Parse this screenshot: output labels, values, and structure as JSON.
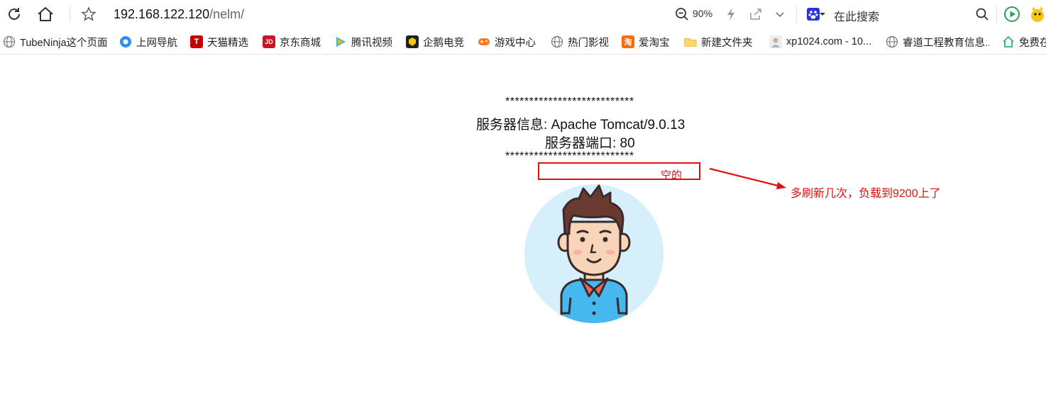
{
  "toolbar": {
    "url_host": "192.168.122.120",
    "url_path": "/nelm/",
    "zoom": "90%",
    "search_placeholder": "在此搜索"
  },
  "bookmarks": [
    {
      "label": "TubeNinja这个页面",
      "icon": "globe-icon",
      "color": "#888888"
    },
    {
      "label": "上网导航",
      "icon": "navigation-icon",
      "color": "#2b8ff0"
    },
    {
      "label": "天猫精选",
      "icon": "tmall-icon",
      "color": "#c40000"
    },
    {
      "label": "京东商城",
      "icon": "jd-icon",
      "color": "#c81623"
    },
    {
      "label": "腾讯视频",
      "icon": "tencent-video-icon",
      "color": "#ff8a00"
    },
    {
      "label": "企鹅电竞",
      "icon": "penguin-esports-icon",
      "color": "#222222"
    },
    {
      "label": "游戏中心",
      "icon": "gamepad-icon",
      "color": "#ff7a1a"
    },
    {
      "label": "热门影视",
      "icon": "globe-icon",
      "color": "#888888"
    },
    {
      "label": "爱淘宝",
      "icon": "taobao-icon",
      "color": "#ff6a00"
    },
    {
      "label": "新建文件夹",
      "icon": "folder-icon",
      "color": "#f5c64d"
    },
    {
      "label": "xp1024.com - 10...",
      "icon": "avatar-icon",
      "color": "#cccccc"
    },
    {
      "label": "睿道工程教育信息...",
      "icon": "globe-icon",
      "color": "#888888"
    },
    {
      "label": "免费在",
      "icon": "home-icon",
      "color": "#2bb673"
    }
  ],
  "content": {
    "stars_top": "***************************",
    "server_info": "服务器信息: Apache Tomcat/9.0.13",
    "server_port": "服务器端口: 80",
    "stars_bottom": "***************************",
    "empty_label": "空的",
    "annotation": "多刷新几次，负载到9200上了"
  },
  "colors": {
    "annotation_red": "#e01010",
    "avatar_bg": "#d6f0fb",
    "shirt": "#45b8f0",
    "hair": "#6b3a2e"
  }
}
